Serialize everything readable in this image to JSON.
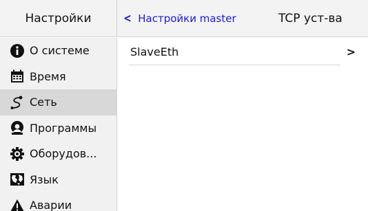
{
  "header": {
    "settings_title": "Настройки",
    "back_label": "Настройки master",
    "page_title": "TCP уст-ва"
  },
  "sidebar": {
    "items": [
      {
        "label": "О системе",
        "icon": "info-icon",
        "active": false
      },
      {
        "label": "Время",
        "icon": "calendar-icon",
        "active": false
      },
      {
        "label": "Сеть",
        "icon": "network-icon",
        "active": true
      },
      {
        "label": "Программы",
        "icon": "programs-icon",
        "active": false
      },
      {
        "label": "Оборудов...",
        "icon": "gear-icon",
        "active": false
      },
      {
        "label": "Язык",
        "icon": "language-map-icon",
        "active": false
      },
      {
        "label": "Аварии",
        "icon": "warning-icon",
        "active": false
      }
    ]
  },
  "main": {
    "rows": [
      {
        "label": "SlaveEth",
        "arrow": "›"
      }
    ]
  },
  "colors": {
    "accent": "#1a1ad6",
    "sidebar_bg": "#f1f1f1",
    "active_bg": "#d8d8d8",
    "header_bg": "#f3f3f3"
  }
}
